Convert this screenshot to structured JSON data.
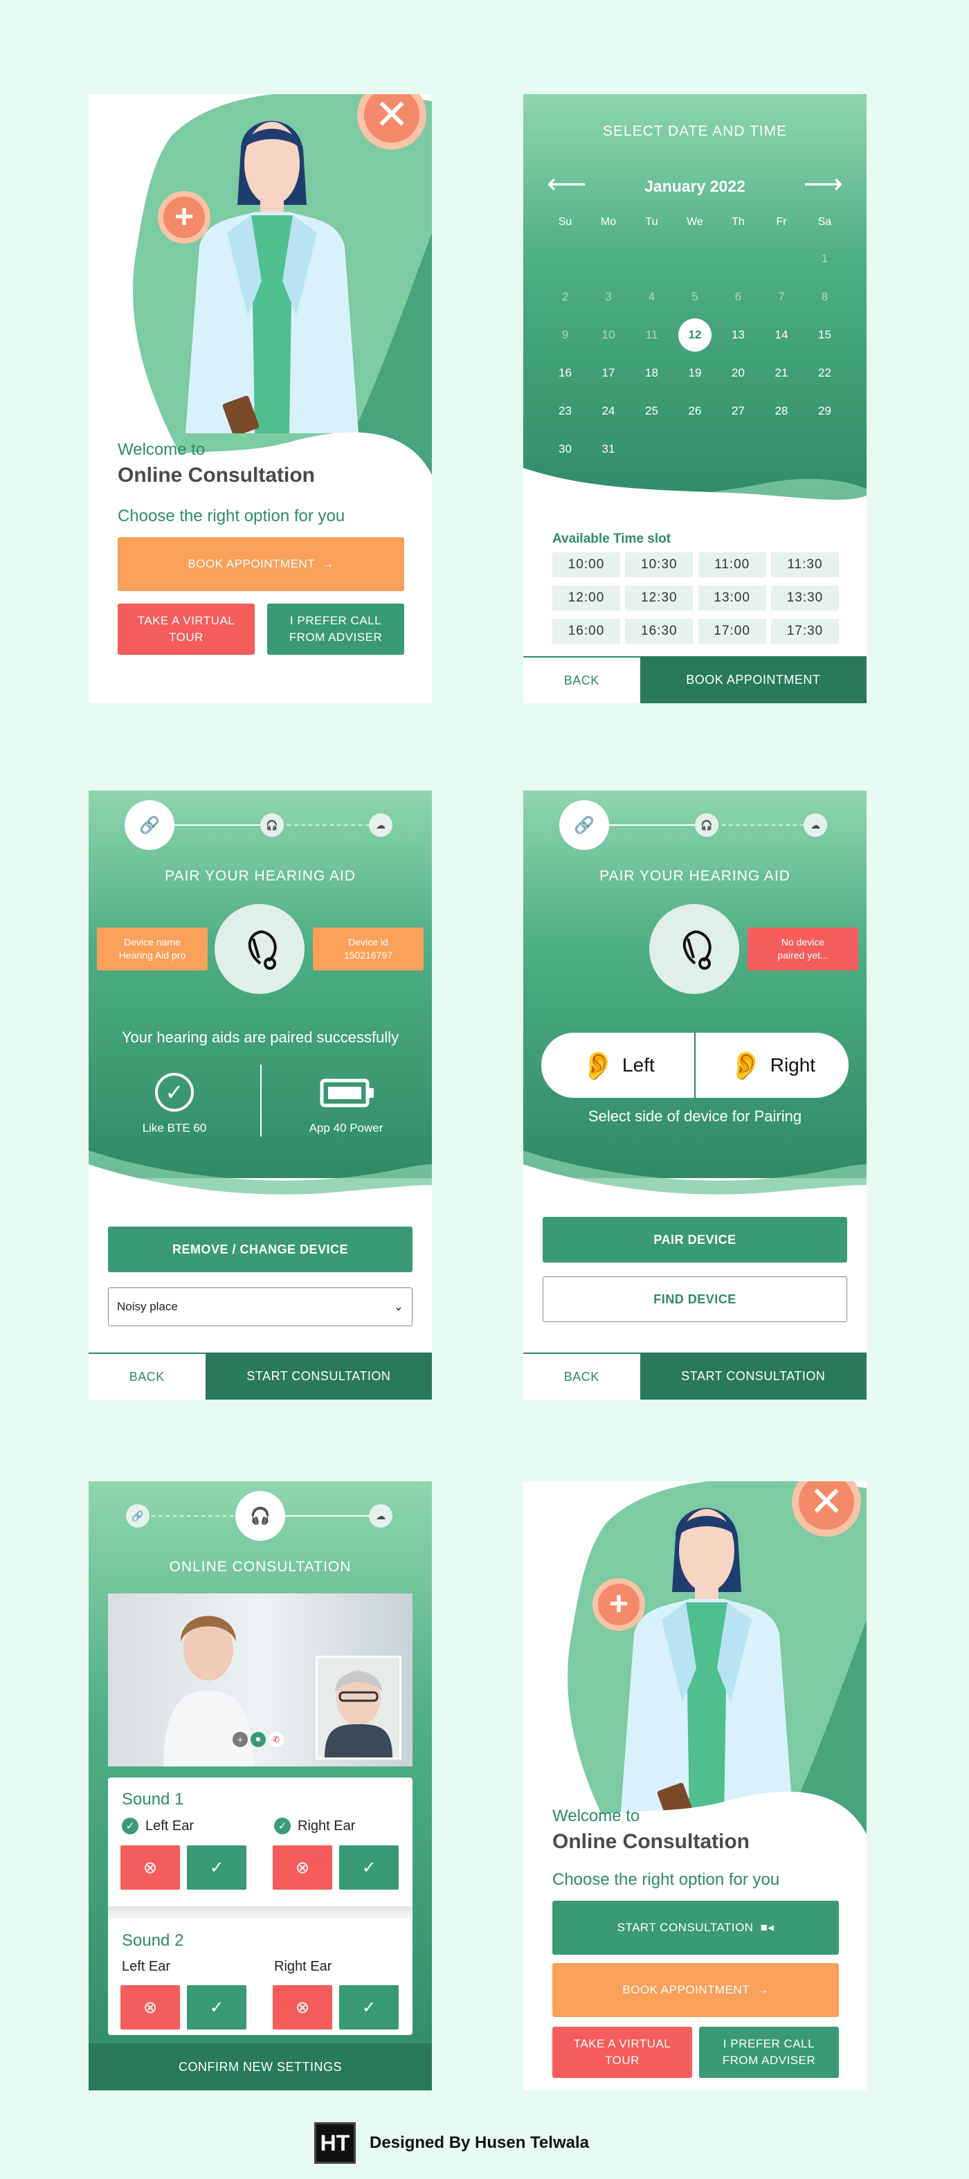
{
  "welcome1": {
    "welcome": "Welcome to",
    "title": "Online Consultation",
    "subtitle": "Choose the right option for you",
    "book_btn": "BOOK APPOINTMENT",
    "virtual_btn": "TAKE A VIRTUAL TOUR",
    "call_btn": "I PREFER CALL FROM ADVISER"
  },
  "calendar": {
    "header": "SELECT DATE AND TIME",
    "month": "January 2022",
    "weekdays": [
      "Su",
      "Mo",
      "Tu",
      "We",
      "Th",
      "Fr",
      "Sa"
    ],
    "rows": [
      [
        "",
        "",
        "",
        "",
        "",
        "",
        "1"
      ],
      [
        "2",
        "3",
        "4",
        "5",
        "6",
        "7",
        "8"
      ],
      [
        "9",
        "10",
        "11",
        "12",
        "13",
        "14",
        "15"
      ],
      [
        "16",
        "17",
        "18",
        "19",
        "20",
        "21",
        "22"
      ],
      [
        "23",
        "24",
        "25",
        "26",
        "27",
        "28",
        "29"
      ],
      [
        "30",
        "31",
        "",
        "",
        "",
        "",
        ""
      ]
    ],
    "selected": "12",
    "slots_title": "Available Time slot",
    "slots": [
      [
        "10:00",
        "10:30",
        "11:00",
        "11:30"
      ],
      [
        "12:00",
        "12:30",
        "13:00",
        "13:30"
      ],
      [
        "16:00",
        "16:30",
        "17:00",
        "17:30"
      ]
    ],
    "back": "BACK",
    "book": "BOOK APPOINTMENT"
  },
  "pair1": {
    "header": "PAIR YOUR HEARING AID",
    "device_name": "Device name",
    "device_name_val": "Hearing Aid pro",
    "device_id": "Device id",
    "device_id_val": "150216797",
    "success": "Your hearing aids are paired successfully",
    "left_label": "Like BTE 60",
    "right_label": "App 40 Power",
    "remove_btn": "REMOVE / CHANGE DEVICE",
    "select_value": "Noisy place",
    "back": "BACK",
    "start": "START CONSULTATION"
  },
  "pair2": {
    "header": "PAIR YOUR HEARING AID",
    "no_device": "No device paired yet...",
    "left": "Left",
    "right": "Right",
    "select_side": "Select side of device for Pairing",
    "pair_btn": "PAIR DEVICE",
    "find_btn": "FIND DEVICE",
    "back": "BACK",
    "start": "START CONSULTATION"
  },
  "consult": {
    "header": "ONLINE CONSULTATION",
    "sound1": "Sound 1",
    "sound2": "Sound 2",
    "left_ear": "Left Ear",
    "right_ear": "Right Ear",
    "confirm": "CONFIRM NEW SETTINGS"
  },
  "welcome2": {
    "welcome": "Welcome to",
    "title": "Online Consultation",
    "subtitle": "Choose the right option for you",
    "start_btn": "START CONSULTATION",
    "book_btn": "BOOK APPOINTMENT",
    "virtual_btn": "TAKE A VIRTUAL TOUR",
    "call_btn": "I PREFER CALL FROM ADVISER"
  },
  "credit": {
    "logo": "HT",
    "text": "Designed By Husen Telwala"
  },
  "colors": {
    "background": "#e8fbf3",
    "green": "#3a9a73",
    "dark_green": "#287a5b",
    "orange": "#f9a05b",
    "red": "#f45d5b"
  }
}
